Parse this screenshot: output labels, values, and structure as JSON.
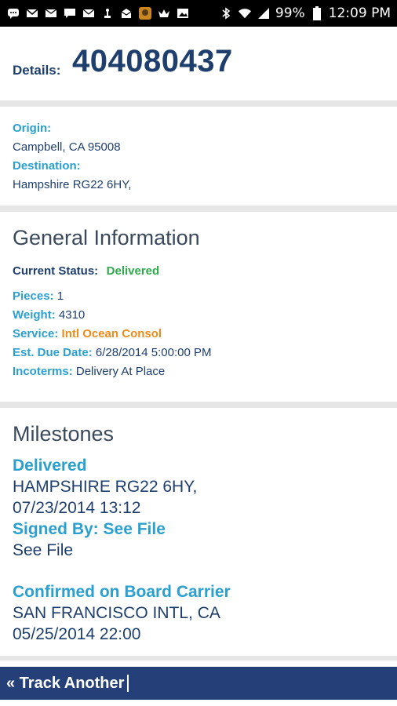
{
  "status_bar": {
    "battery": "99%",
    "time": "12:09 PM",
    "icons": [
      "messages-icon",
      "gmail-icon",
      "email-icon",
      "chat-icon",
      "mail-icon",
      "usb-icon",
      "inbox-icon",
      "avatar-icon",
      "crown-icon",
      "image-icon",
      "bluetooth-icon",
      "wifi-icon",
      "signal-icon",
      "battery-icon"
    ]
  },
  "header": {
    "label": "Details:",
    "tracking_number": "404080437"
  },
  "route": {
    "origin_label": "Origin:",
    "origin_value": "Campbell, CA 95008",
    "destination_label": "Destination:",
    "destination_value": "Hampshire RG22 6HY,"
  },
  "general": {
    "title": "General Information",
    "status_label": "Current Status:",
    "status_value": "Delivered",
    "pieces_label": "Pieces:",
    "pieces_value": "1",
    "weight_label": "Weight:",
    "weight_value": "4310",
    "service_label": "Service:",
    "service_value": "Intl Ocean Consol",
    "due_label": "Est. Due Date:",
    "due_value": "6/28/2014 5:00:00 PM",
    "incoterms_label": "Incoterms:",
    "incoterms_value": "Delivery At Place"
  },
  "milestones": {
    "title": "Milestones",
    "items": [
      {
        "status": "Delivered",
        "location": "HAMPSHIRE RG22 6HY,",
        "datetime": "07/23/2014 13:12",
        "signed_label": "Signed By: See File",
        "signed_value": "See File"
      },
      {
        "status": "Confirmed on Board Carrier",
        "location": "SAN FRANCISCO INTL, CA",
        "datetime": "05/25/2014 22:00"
      }
    ]
  },
  "bottom": {
    "track_another": "« Track Another"
  },
  "colors": {
    "navy": "#1e3f6e",
    "blue_label": "#2aa0d0",
    "green_status": "#2eaa4a",
    "orange_service": "#f08a1c",
    "bottom_bar": "#253f78"
  }
}
